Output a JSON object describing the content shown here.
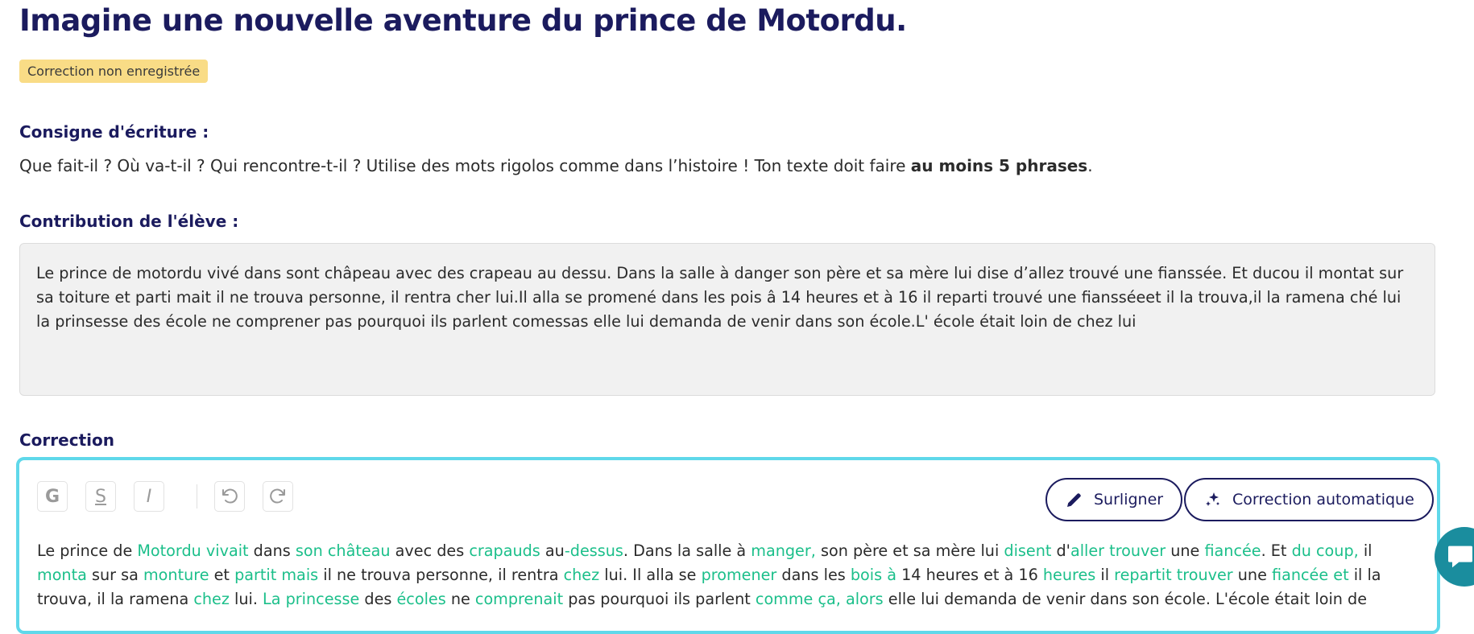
{
  "title": "Imagine une nouvelle aventure du prince de Motordu.",
  "badge": "Correction non enregistrée",
  "instructions": {
    "heading": "Consigne d'écriture :",
    "text": "Que fait-il ? Où va-t-il ? Qui rencontre-t-il ? Utilise des mots rigolos comme dans l’histoire ! Ton texte doit faire ",
    "bold": "au moins 5 phrases",
    "end": "."
  },
  "contribution": {
    "heading": "Contribution de l'élève :",
    "text": "Le prince de motordu vivé dans sont châpeau avec des crapeau au dessu. Dans la salle à danger son père et sa mère lui dise d’allez trouvé une fianssée. Et ducou il montat sur sa toiture et parti mait il ne trouva personne, il rentra cher lui.Il alla se promené dans les pois â 14 heures et à 16 il reparti trouvé une fiansséeet il la trouva,il la ramena ché lui la prinsesse des école ne comprener pas pourquoi ils parlent comessas elle lui demanda de venir dans son école.L' école était loin de chez lui"
  },
  "correction": {
    "heading": "Correction",
    "toolbar": {
      "bold": "G",
      "strike": "S",
      "italic": "I",
      "highlight_label": "Surligner",
      "auto_label": "Correction automatique"
    },
    "segments": [
      {
        "t": "Le prince de ",
        "c": false
      },
      {
        "t": "Motordu vivait",
        "c": true
      },
      {
        "t": " dans ",
        "c": false
      },
      {
        "t": "son château",
        "c": true
      },
      {
        "t": " avec des ",
        "c": false
      },
      {
        "t": "crapauds",
        "c": true
      },
      {
        "t": " au",
        "c": false
      },
      {
        "t": "-dessus",
        "c": true
      },
      {
        "t": ". Dans la salle à ",
        "c": false
      },
      {
        "t": "manger,",
        "c": true
      },
      {
        "t": " son père et sa mère lui ",
        "c": false
      },
      {
        "t": "disent",
        "c": true
      },
      {
        "t": " d'",
        "c": false
      },
      {
        "t": "aller trouver",
        "c": true
      },
      {
        "t": " une ",
        "c": false
      },
      {
        "t": "fiancée",
        "c": true
      },
      {
        "t": ". Et ",
        "c": false
      },
      {
        "t": "du coup,",
        "c": true
      },
      {
        "t": " il ",
        "c": false
      },
      {
        "t": "monta",
        "c": true
      },
      {
        "t": " sur sa ",
        "c": false
      },
      {
        "t": "monture",
        "c": true
      },
      {
        "t": " et ",
        "c": false
      },
      {
        "t": "partit mais",
        "c": true
      },
      {
        "t": " il ne trouva personne, il rentra ",
        "c": false
      },
      {
        "t": "chez",
        "c": true
      },
      {
        "t": " lui. Il alla se ",
        "c": false
      },
      {
        "t": "promener",
        "c": true
      },
      {
        "t": " dans les ",
        "c": false
      },
      {
        "t": "bois à",
        "c": true
      },
      {
        "t": " 14 heures et à 16 ",
        "c": false
      },
      {
        "t": "heures",
        "c": true
      },
      {
        "t": " il ",
        "c": false
      },
      {
        "t": "repartit trouver",
        "c": true
      },
      {
        "t": " une ",
        "c": false
      },
      {
        "t": "fiancée et",
        "c": true
      },
      {
        "t": " il la trouva, il la ramena ",
        "c": false
      },
      {
        "t": "chez",
        "c": true
      },
      {
        "t": " lui. ",
        "c": false
      },
      {
        "t": "La princesse",
        "c": true
      },
      {
        "t": " des ",
        "c": false
      },
      {
        "t": "écoles",
        "c": true
      },
      {
        "t": " ne ",
        "c": false
      },
      {
        "t": "comprenait",
        "c": true
      },
      {
        "t": " pas pourquoi ils parlent ",
        "c": false
      },
      {
        "t": "comme ça, alors",
        "c": true
      },
      {
        "t": " elle lui demanda de venir dans son école. L'école était loin de",
        "c": false
      }
    ]
  },
  "colors": {
    "heading": "#1b1b5e",
    "badge_bg": "#f9dc86",
    "correction": "#1bbf8a",
    "editor_border": "#5fd8ea",
    "chat_button": "#1a8d9e"
  },
  "icons": [
    "pencil-icon",
    "sparkles-icon",
    "undo-icon",
    "redo-icon",
    "chat-icon"
  ]
}
